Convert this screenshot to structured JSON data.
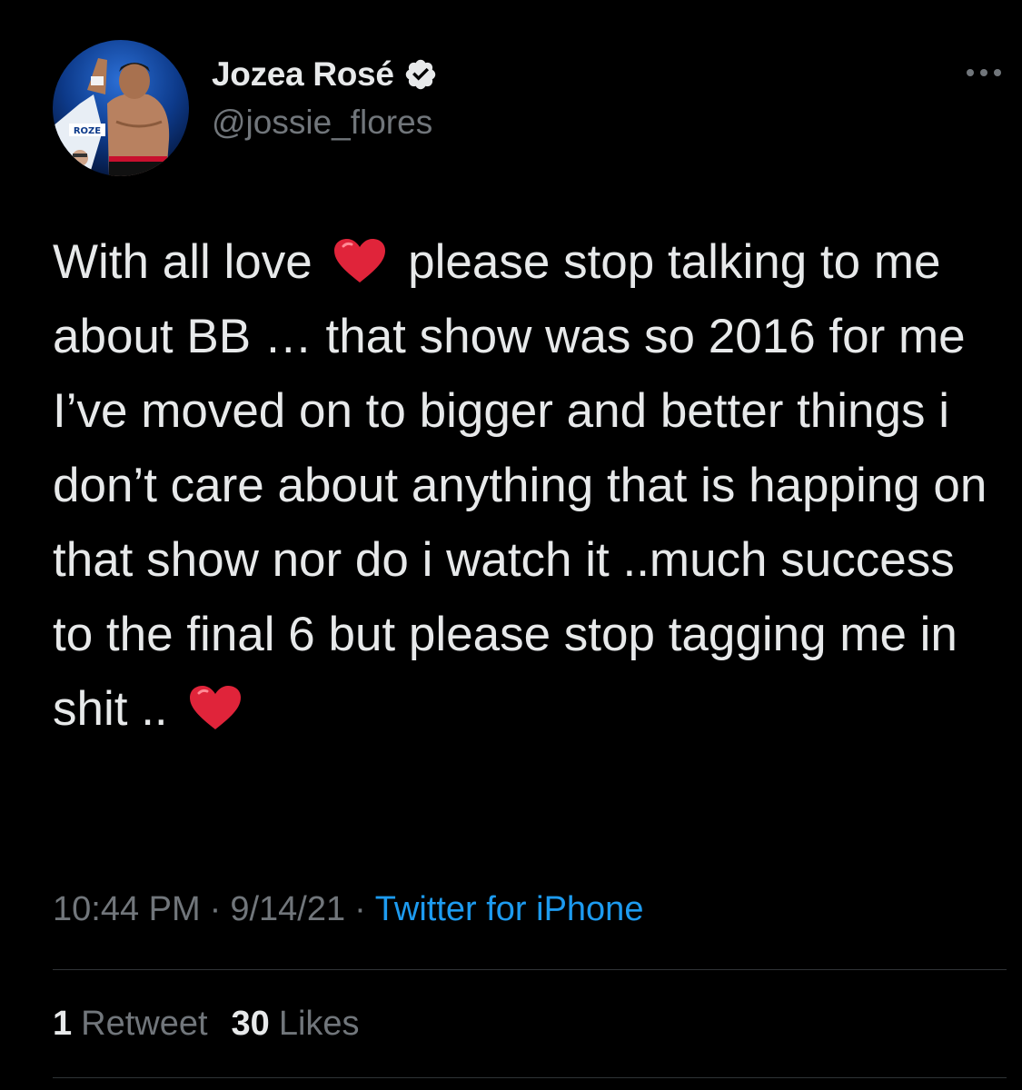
{
  "author": {
    "display_name": "Jozea Rosé",
    "handle": "@jossie_flores",
    "avatar_icon": "avatar-boxer-photo",
    "avatar_text": "ROZE",
    "verified_icon": "verified-badge-icon"
  },
  "more_icon": "more-options-icon",
  "tweet": {
    "segments": [
      {
        "text": "With all love "
      },
      {
        "icon": "red-heart-emoji"
      },
      {
        "text": " please stop talking to me about BB … that show was so 2016 for me I’ve moved on to bigger and better things i don’t care about anything that is happing on that show nor do i watch it ..much success to the final 6 but please stop tagging me in shit .. "
      },
      {
        "icon": "red-heart-emoji"
      }
    ],
    "part1": "With all love ",
    "part2": " please stop talking to me about BB … that show was so 2016 for me I’ve moved on to bigger and better things i don’t care about anything that is happing on that show nor do i watch it ..much success to the final 6 but please stop tagging me in shit .. "
  },
  "meta": {
    "time": "10:44 PM",
    "separator": "·",
    "date": "9/14/21",
    "source": "Twitter for iPhone"
  },
  "stats": {
    "retweets_count": "1",
    "retweets_label": "Retweet",
    "likes_count": "30",
    "likes_label": "Likes"
  },
  "colors": {
    "background": "#000000",
    "text": "#e7e9ea",
    "muted": "#71767b",
    "link": "#1d9bf0",
    "divider": "#2f3336",
    "heart": "#e0243a"
  }
}
